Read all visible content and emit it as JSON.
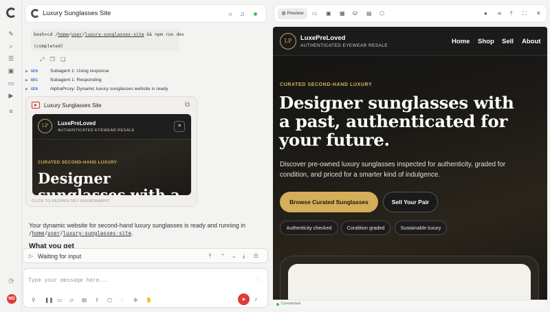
{
  "rail": {
    "icons": [
      "new-chat-icon",
      "search-icon",
      "sliders-icon",
      "inbox-icon",
      "folder-icon",
      "video-icon",
      "tasks-icon",
      "history-icon"
    ],
    "avatar_initials": "MD"
  },
  "chat": {
    "title": "Luxury Sunglasses Site",
    "terminal": {
      "command_prefix": "bash>cd /",
      "path_parts": [
        "home",
        "user",
        "luxury-sunglasses-site"
      ],
      "command_suffix": " && npm run dev",
      "status": "(completed)"
    },
    "log": [
      {
        "tag": "GEN",
        "text": "Subagent 1: Using response"
      },
      {
        "tag": "RES",
        "text": "Subagent 1: Responding"
      },
      {
        "tag": "GEN",
        "text": "AlphaProxy: Dynamic luxury sunglasses website is ready"
      }
    ],
    "card": {
      "title": "Luxury Sunglasses Site",
      "reopen_label": "CLICK TO REOPEN DEV ENVIRONMENT",
      "preview_brand": "LuxePreLoved",
      "preview_tagline": "AUTHENTICATED EYEWEAR RESALE",
      "preview_eyebrow": "CURATED SECOND-HAND LUXURY",
      "preview_hero": "Designer sunglasses with a past"
    },
    "message": {
      "text": "Your dynamic website for second-hand luxury sunglasses is ready and running in",
      "path": "/home/user/luxury-sunglasses-site",
      "heading": "What you get"
    },
    "wait_label": "Waiting for input",
    "input_placeholder": "Type your message here..."
  },
  "preview": {
    "tab_label": "Preview",
    "status": "Connected",
    "site": {
      "logo_initials": "LP",
      "brand": "LuxePreLoved",
      "tagline": "AUTHENTICATED EYEWEAR RESALE",
      "nav": [
        "Home",
        "Shop",
        "Sell",
        "About"
      ],
      "eyebrow": "CURATED SECOND-HAND LUXURY",
      "hero": "Designer sunglasses with a past, authenticated for your future.",
      "description": "Discover pre-owned luxury sunglasses inspected for authenticity, graded for condition, and priced for a smarter kind of indulgence.",
      "cta_primary": "Browse Curated Sunglasses",
      "cta_secondary": "Sell Your Pair",
      "chips": [
        "Authenticity checked",
        "Condition graded",
        "Sustainable luxury"
      ]
    }
  },
  "colors": {
    "accent_gold": "#d4ae58",
    "status_green": "#33c25a",
    "send_red": "#e03a3a"
  }
}
